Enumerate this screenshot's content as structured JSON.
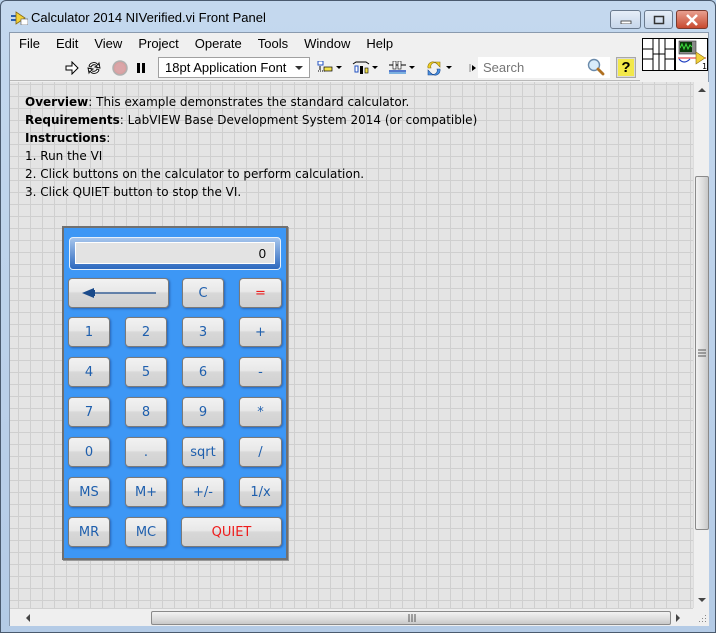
{
  "window": {
    "title": "Calculator 2014 NIVerified.vi Front Panel",
    "controls": [
      "minimize",
      "maximize",
      "close"
    ]
  },
  "menubar": {
    "items": [
      "File",
      "Edit",
      "View",
      "Project",
      "Operate",
      "Tools",
      "Window",
      "Help"
    ]
  },
  "toolbar": {
    "icons": [
      "run-arrow-icon",
      "run-continuously-icon",
      "abort-icon",
      "pause-icon",
      "align-objects-icon",
      "distribute-objects-icon",
      "resize-objects-icon",
      "reorder-icon"
    ],
    "font_select": "18pt Application Font",
    "search_placeholder": "Search",
    "help_label": "?",
    "vi_icon_label": "1"
  },
  "description": {
    "overview_label": "Overview",
    "overview_text": ": This example demonstrates the standard calculator.",
    "requirements_label": "Requirements",
    "requirements_text": ": LabVIEW Base Development System 2014 (or compatible)",
    "instructions_label": "Instructions",
    "instructions_colon": ":",
    "steps": [
      "1. Run the VI",
      "2. Click buttons on the calculator to perform calculation.",
      "3. Click QUIET button to stop the VI."
    ]
  },
  "calculator": {
    "display_value": "0",
    "accent_color": "#3d97f5",
    "buttons": {
      "c": "C",
      "equals": "=",
      "one": "1",
      "two": "2",
      "three": "3",
      "plus": "+",
      "four": "4",
      "five": "5",
      "six": "6",
      "minus": "-",
      "seven": "7",
      "eight": "8",
      "nine": "9",
      "multiply": "*",
      "zero": "0",
      "dot": ".",
      "sqrt": "sqrt",
      "divide": "/",
      "ms": "MS",
      "mplus": "M+",
      "negate": "+/-",
      "reciprocal": "1/x",
      "mr": "MR",
      "mc": "MC",
      "quiet": "QUIET"
    }
  }
}
